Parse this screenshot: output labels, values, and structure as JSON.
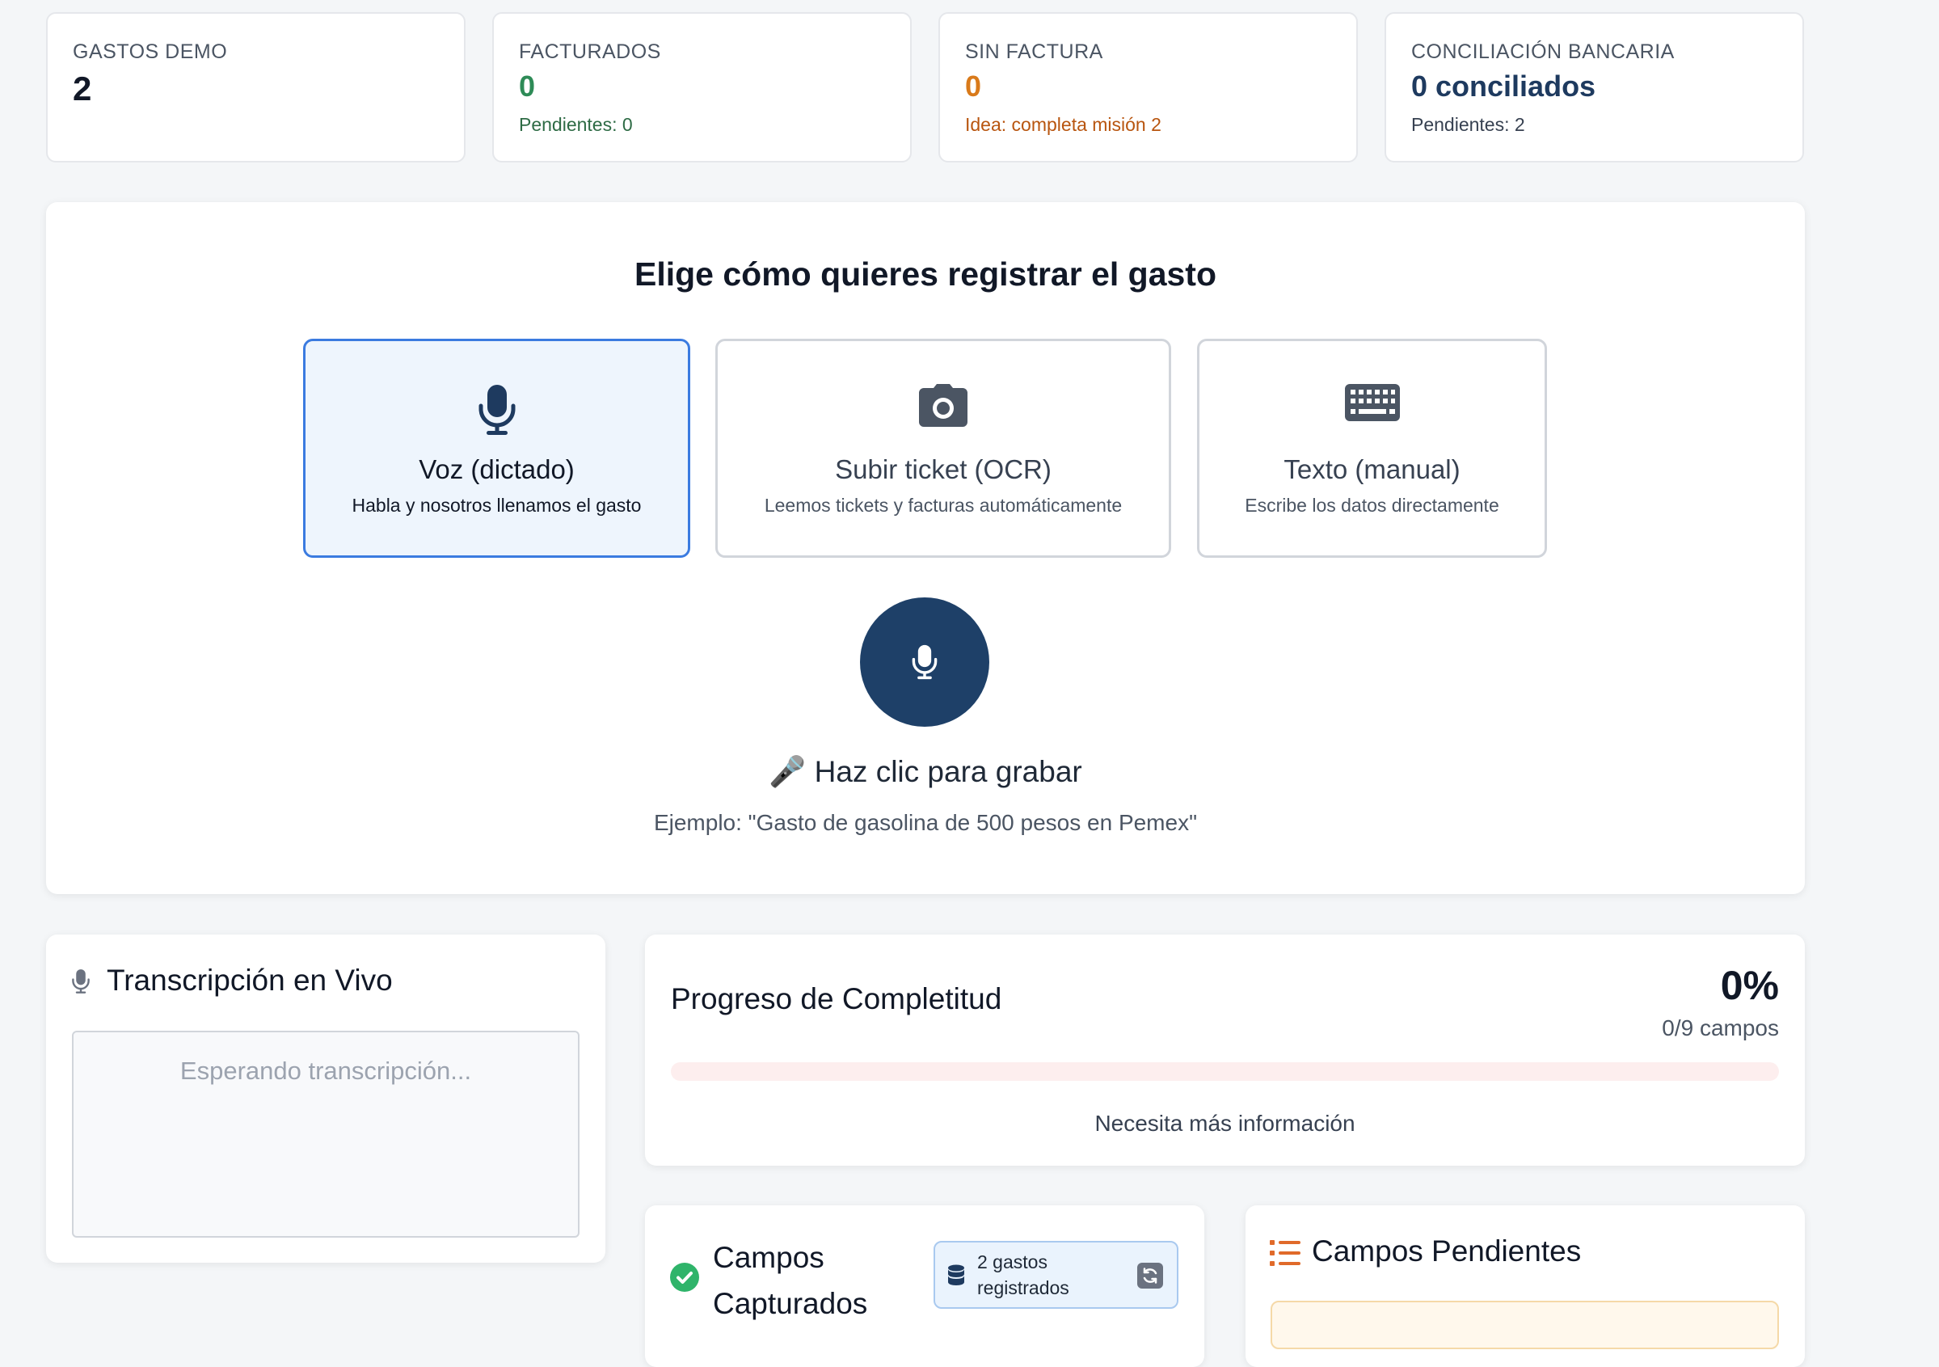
{
  "stats": [
    {
      "label": "GASTOS DEMO",
      "value": "2",
      "sub": ""
    },
    {
      "label": "FACTURADOS",
      "value": "0",
      "sub": "Pendientes: 0"
    },
    {
      "label": "SIN FACTURA",
      "value": "0",
      "sub": "Idea: completa misión 2"
    },
    {
      "label": "CONCILIACIÓN BANCARIA",
      "value": "0 conciliados",
      "sub": "Pendientes: 2"
    }
  ],
  "colors": {
    "primary": "#1e4068",
    "green": "#2e8b57",
    "orange": "#d97a1a",
    "accent_blue": "#3b7be0",
    "danger": "#e24b4b"
  },
  "method": {
    "title": "Elige cómo quieres registrar el gasto",
    "options": [
      {
        "icon": "microphone-icon",
        "title": "Voz (dictado)",
        "desc": "Habla y nosotros llenamos el gasto",
        "selected": true
      },
      {
        "icon": "camera-icon",
        "title": "Subir ticket (OCR)",
        "desc": "Leemos tickets y facturas automáticamente",
        "selected": false
      },
      {
        "icon": "keyboard-icon",
        "title": "Texto (manual)",
        "desc": "Escribe los datos directamente",
        "selected": false
      }
    ],
    "record_label": "🎤 Haz clic para grabar",
    "example": "Ejemplo: \"Gasto de gasolina de 500 pesos en Pemex\""
  },
  "transcription": {
    "title": "Transcripción en Vivo",
    "placeholder": "Esperando transcripción..."
  },
  "progress": {
    "title": "Progreso de Completitud",
    "percent_label": "0%",
    "fields_label": "0/9 campos",
    "fraction": 0,
    "status": "Necesita más información"
  },
  "captured": {
    "title_line1": "Campos",
    "title_line2": "Capturados",
    "badge_line1": "2 gastos",
    "badge_line2": "registrados"
  },
  "pending": {
    "title": "Campos Pendientes"
  }
}
